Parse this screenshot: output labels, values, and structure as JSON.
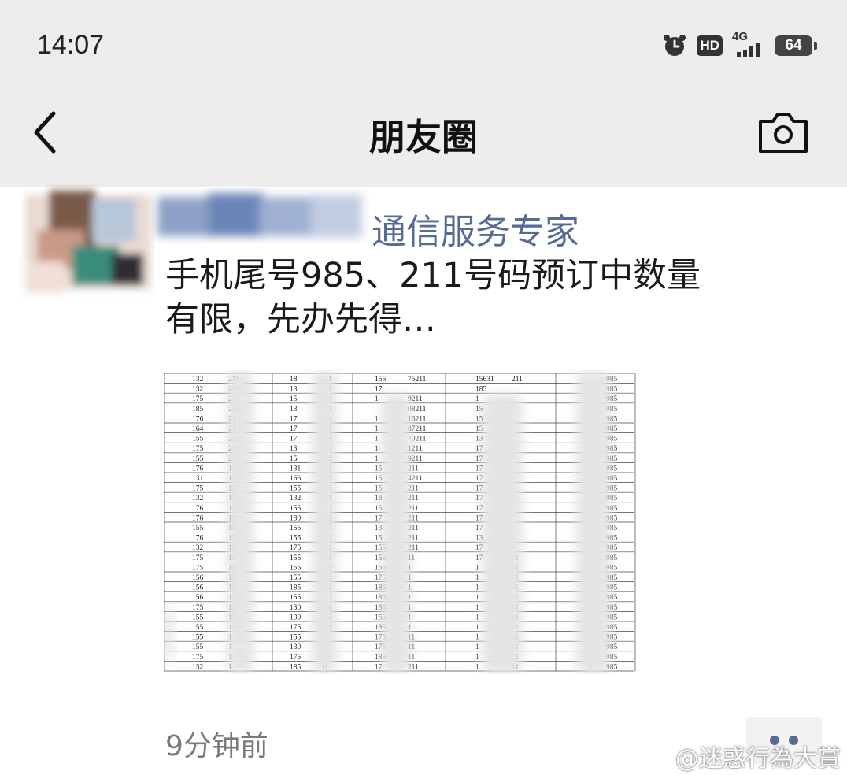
{
  "status": {
    "time": "14:07",
    "hd": "HD",
    "network": "4G",
    "battery": "64"
  },
  "header": {
    "title": "朋友圈"
  },
  "post": {
    "author": "通信服务专家",
    "text_lines": [
      "手机尾号985、211号码预订中数量",
      "有限，先办先得…"
    ],
    "time": "9分钟前",
    "image_table": {
      "rows": [
        [
          "132",
          "211",
          "18",
          "211",
          "156",
          "75211",
          "15631",
          "211",
          "",
          "985"
        ],
        [
          "132",
          "211",
          "13",
          "211",
          "17",
          "",
          "185",
          "",
          "",
          "985"
        ],
        [
          "175",
          "211",
          "15",
          "211",
          "1",
          "9211",
          "1",
          "",
          "",
          "985"
        ],
        [
          "185",
          "211",
          "13",
          "211",
          "",
          "08211",
          "15",
          "",
          "",
          "985"
        ],
        [
          "176",
          "211",
          "17",
          "211",
          "1",
          "16211",
          "15",
          "",
          "",
          "985"
        ],
        [
          "164",
          "211",
          "17",
          "211",
          "1",
          "87211",
          "15",
          "",
          "",
          "985"
        ],
        [
          "155",
          "211",
          "17",
          "211",
          "1",
          "70211",
          "13",
          "",
          "",
          "985"
        ],
        [
          "175",
          "211",
          "13",
          "211",
          "1",
          "1211",
          "17",
          "",
          "",
          "985"
        ],
        [
          "155",
          "211",
          "15",
          "211",
          "1",
          "9211",
          "17",
          "",
          "",
          "985"
        ],
        [
          "176",
          "11",
          "131",
          "211",
          "15",
          "211",
          "17",
          "",
          "",
          "985"
        ],
        [
          "131",
          "11",
          "166",
          "211",
          "15",
          "4211",
          "17",
          "",
          "",
          "985"
        ],
        [
          "175",
          "11",
          "155",
          "211",
          "15",
          "211",
          "17",
          "",
          "",
          "985"
        ],
        [
          "132",
          "11",
          "132",
          "211",
          "18",
          "211",
          "17",
          "",
          "",
          "985"
        ],
        [
          "176",
          "11",
          "155",
          "211",
          "15",
          "211",
          "17",
          "",
          "",
          "985"
        ],
        [
          "176",
          "11",
          "130",
          "211",
          "17",
          "211",
          "17",
          "",
          "",
          "985"
        ],
        [
          "155",
          "11",
          "155",
          "211",
          "13",
          "211",
          "17",
          "",
          "",
          "985"
        ],
        [
          "176",
          "11",
          "155",
          "211",
          "15",
          "211",
          "13",
          "",
          "",
          "985"
        ],
        [
          "132",
          "11",
          "175",
          "211",
          "155",
          "211",
          "17",
          "",
          "",
          "985"
        ],
        [
          "175",
          "11",
          "155",
          "211",
          "156",
          "11",
          "17",
          "11",
          "",
          "985"
        ],
        [
          "175",
          "11",
          "155",
          "211",
          "156",
          "1",
          "1",
          "11",
          "1",
          "985"
        ],
        [
          "156",
          "11",
          "155",
          "211",
          "176",
          "1",
          "1",
          "11",
          "1",
          "985"
        ],
        [
          "156",
          "11",
          "185",
          "211",
          "186",
          "1",
          "1",
          "11",
          "1",
          "985"
        ],
        [
          "156",
          "11",
          "155",
          "211",
          "185",
          "1",
          "1",
          "11",
          "1",
          "985"
        ],
        [
          "175",
          "11",
          "130",
          "211",
          "155",
          "1",
          "1",
          "11",
          "1",
          "985"
        ],
        [
          "155",
          "11",
          "130",
          "211",
          "156",
          "1",
          "1",
          "11",
          "1",
          "985"
        ],
        [
          "155",
          "11",
          "175",
          "211",
          "185",
          "1",
          "1",
          "11",
          "1",
          "985"
        ],
        [
          "155",
          "1",
          "155",
          "11",
          "175",
          "11",
          "1",
          "11",
          "1",
          "985"
        ],
        [
          "155",
          "1",
          "130",
          "11",
          "175",
          "11",
          "1",
          "11",
          "1",
          "985"
        ],
        [
          "175",
          "1",
          "175",
          "11",
          "185",
          "11",
          "1",
          "11",
          "1",
          "985"
        ],
        [
          "132",
          "1",
          "185",
          "11",
          "17",
          "211",
          "1",
          "11",
          "1",
          "985"
        ]
      ]
    }
  },
  "watermark": "@迷惑行為大賞",
  "colors": {
    "link": "#576b95",
    "header_bg": "#ededed",
    "time_gray": "#7a7a7a"
  }
}
